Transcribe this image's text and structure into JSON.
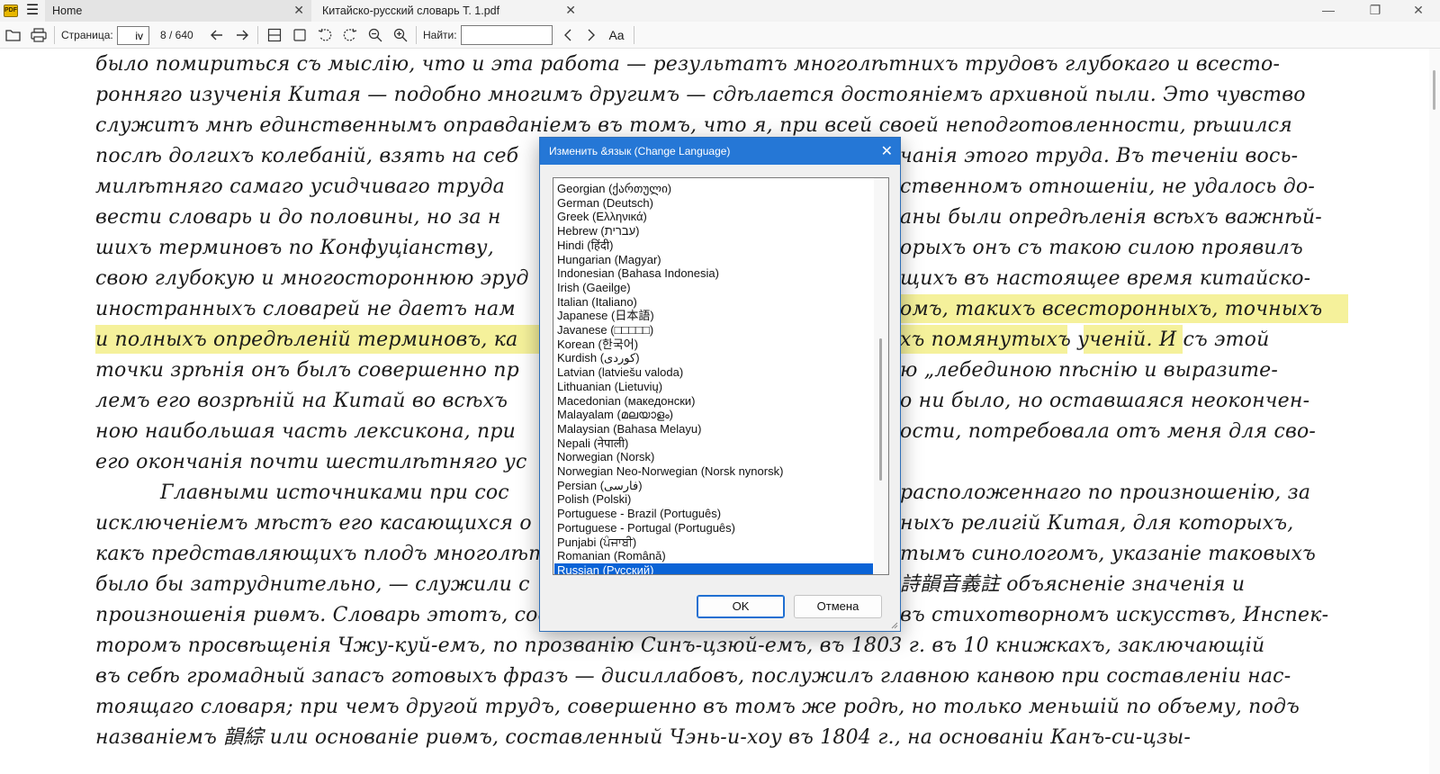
{
  "app": {
    "icon_text": "PDF"
  },
  "tabs": [
    {
      "label": "Home"
    },
    {
      "label": "Китайско-русский словарь Т. 1.pdf"
    }
  ],
  "window_controls": {
    "minimize": "—",
    "restore": "❐",
    "close": "✕"
  },
  "toolbar": {
    "page_label": "Страница:",
    "page_value": "iv",
    "page_count": "8 / 640",
    "find_label": "Найти:",
    "find_value": "",
    "case_label": "Aa",
    "icons": [
      "open-folder-icon",
      "print-icon",
      "back-arrow-icon",
      "forward-arrow-icon",
      "fit-page-icon",
      "fit-width-icon",
      "rotate-left-icon",
      "rotate-right-icon",
      "zoom-out-icon",
      "zoom-in-icon",
      "find-prev-icon",
      "find-next-icon",
      "match-case-icon"
    ]
  },
  "document": {
    "lines": [
      "было помириться съ мыслію, что и эта работа — результатъ многолѣтнихъ трудовъ глубокаго и всесто-",
      "ронняго изученія Китая — подобно многимъ другимъ — сдѣлается достояніемъ архивной пыли. Это чувство",
      "служитъ мнѣ единственнымъ оправданіемъ въ томъ, что я, при всей своей неподготовленности, рѣшился",
      "послѣ долгихъ колебаній, взять на себ",
      "милѣтняго самаго усидчиваго труда",
      "вести словарь и до половины, но за н",
      "шихъ терминовъ по Конфуціанству,",
      "свою глубокую и многостороннюю эруд",
      "иностранныхъ словарей не даетъ нам",
      "и полныхъ опредѣленій терминовъ, ка",
      "точки зрѣнія онъ былъ совершенно пр",
      "лемъ его возрѣній на Китай во всѣхъ",
      "ною наибольшая часть лексикона, при",
      "его окончанія почти шестилѣтняго ус",
      "Главными источниками при сос",
      "исключеніемъ мѣстъ его касающихся о",
      "какъ представляющихъ плодъ многолѣт",
      "было бы затруднительно, — служили с",
      "произношенія риѳмъ. Словарь этотъ, составленный, для руководства",
      "торомъ просвѣщенія Чжу-куй-емъ, по прозванію Синъ-цзюй-емъ, въ 1803 г. въ 10 книжкахъ, заключающій",
      "въ себѣ громадный запасъ готовыхъ фразъ — дисиллабовъ, послужилъ главною канвою при составленіи нас-",
      "тоящаго словаря; при чемъ другой трудъ, совершенно въ томъ же родѣ, но только меньшій по объему, подъ",
      "названіемъ 韻綜 или основаніе риѳмъ, составленный Чэнь-и-хоу въ 1804 г., на основаніи Канъ-си-цзы-"
    ],
    "right_lines": [
      "",
      "",
      "",
      "чанія этого труда. Въ теченіи вось-",
      "ственномъ отношеніи, не удалось до-",
      "аны были опредѣленія всѣхъ важнѣй-",
      "орыхъ онъ съ такою силою проявилъ",
      "щихъ въ настоящее время китайско-",
      "омъ, такихъ всесторонныхъ, точныхъ",
      "хъ помянутыхъ ученій. И съ этой",
      "ю „лебединою пѣснію и выразите-",
      "о ни было, но оставшаяся неокончен-",
      "ости, потребовала отъ меня для сво-",
      "",
      "расположеннаго по произношенію, за",
      "ныхъ религій Китая, для которыхъ,",
      "тымъ синологомъ, указаніе таковыхъ",
      "詩韻音義註 объясненіе значенія и",
      "въ стихотворномъ искусствъ, Инспек-",
      "",
      "",
      "",
      ""
    ]
  },
  "dialog": {
    "title": "Изменить &язык (Change Language)",
    "close": "✕",
    "languages": [
      "Georgian (ქართული)",
      "German (Deutsch)",
      "Greek (Ελληνικά)",
      "Hebrew (עברית)",
      "Hindi (हिंदी)",
      "Hungarian (Magyar)",
      "Indonesian (Bahasa Indonesia)",
      "Irish (Gaeilge)",
      "Italian (Italiano)",
      "Japanese (日本語)",
      "Javanese (□□□□□)",
      "Korean (한국어)",
      "Kurdish (کوردی)",
      "Latvian (latviešu valoda)",
      "Lithuanian (Lietuvių)",
      "Macedonian (македонски)",
      "Malayalam (മലയാളം)",
      "Malaysian (Bahasa Melayu)",
      "Nepali (नेपाली)",
      "Norwegian (Norsk)",
      "Norwegian Neo-Norwegian (Norsk nynorsk)",
      "Persian (فارسی)",
      "Polish (Polski)",
      "Portuguese - Brazil (Português)",
      "Portuguese - Portugal (Português)",
      "Punjabi (ਪੰਜਾਬੀ)",
      "Romanian (Română)",
      "Russian (Русский)"
    ],
    "selected": "Russian (Русский)",
    "ok_label": "OK",
    "cancel_label": "Отмена"
  },
  "colors": {
    "accent": "#2577d6",
    "selection": "#0a63d6",
    "highlight": "#f3ee8a"
  }
}
